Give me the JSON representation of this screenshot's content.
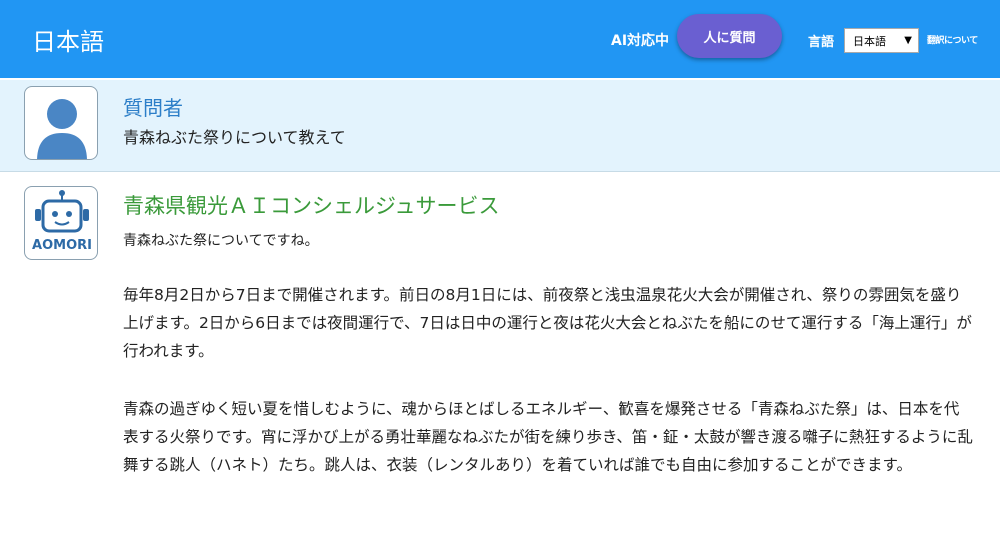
{
  "header": {
    "title": "日本語",
    "ai_status": "AI対応中",
    "ask_human_label": "人に質問",
    "lang_label": "言語",
    "lang_selected": "日本語",
    "about_translation": "翻訳について"
  },
  "user_message": {
    "sender": "質問者",
    "text": "青森ねぶた祭りについて教えて"
  },
  "bot_message": {
    "sender": "青森県観光ＡＩコンシェルジュサービス",
    "logo_text": "AOMORI",
    "lead": "青森ねぶた祭についてですね。",
    "paragraphs": [
      "毎年8月2日から7日まで開催されます。前日の8月1日には、前夜祭と浅虫温泉花火大会が開催され、祭りの雰囲気を盛り上げます。2日から6日までは夜間運行で、7日は日中の運行と夜は花火大会とねぶたを船にのせて運行する「海上運行」が行われます。",
      "青森の過ぎゆく短い夏を惜しむように、魂からほとばしるエネルギー、歓喜を爆発させる「青森ねぶた祭」は、日本を代表する火祭りです。宵に浮かび上がる勇壮華麗なねぶたが街を練り歩き、笛・鉦・太鼓が響き渡る囃子に熱狂するように乱舞する跳人（ハネト）たち。跳人は、衣装（レンタルあり）を着ていれば誰でも自由に参加することができます。"
    ]
  },
  "colors": {
    "header_bg": "#2196f3",
    "ask_human_bg": "#6a5fd1",
    "user_row_bg": "#e3f3fd",
    "user_name": "#2c7ec8",
    "bot_name": "#3a9a3a"
  }
}
